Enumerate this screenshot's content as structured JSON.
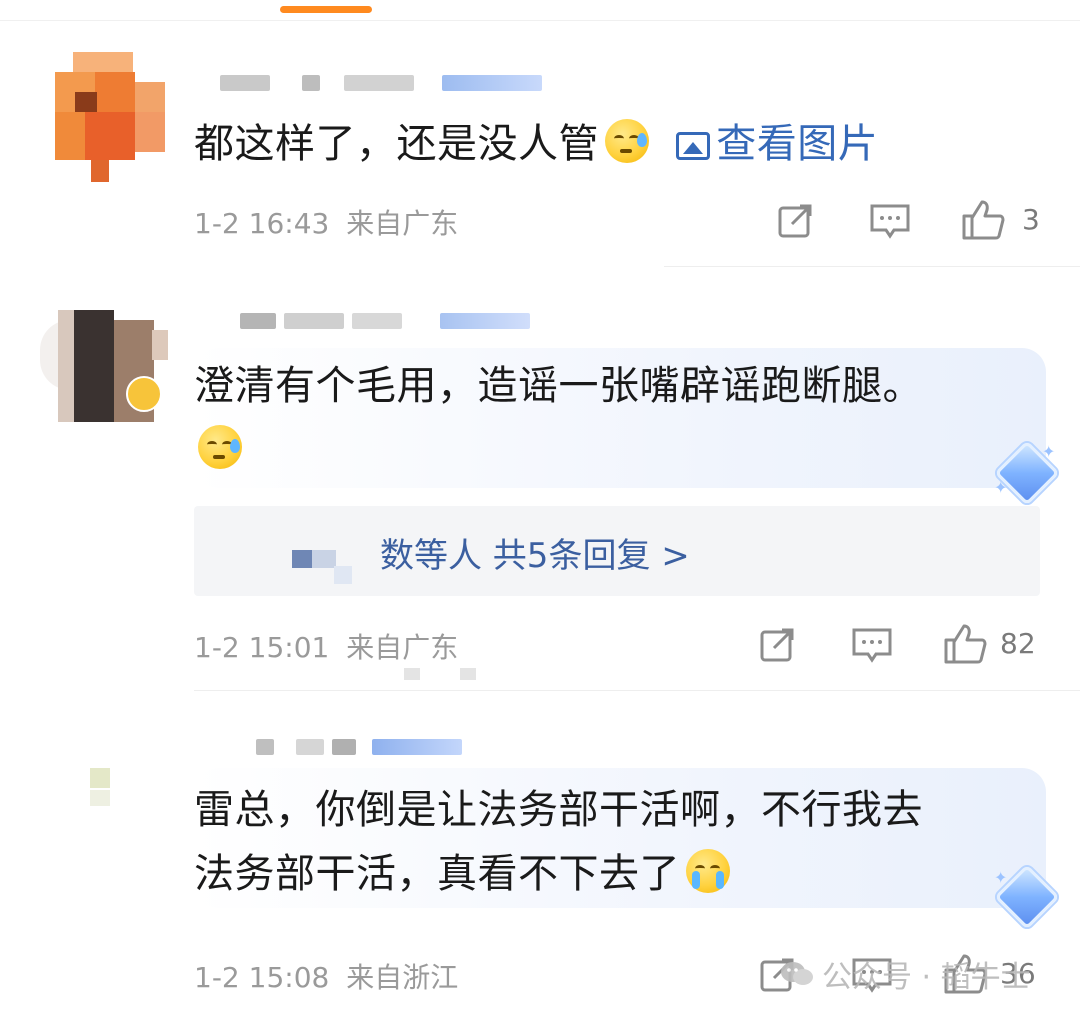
{
  "comments": [
    {
      "text": "都这样了，还是没人管",
      "view_image_label": "查看图片",
      "time": "1-2 16:43",
      "location": "来自广东",
      "likes": "3"
    },
    {
      "text_line1": "澄清有个毛用，造谣一张嘴辟谣跑断腿。",
      "time": "1-2 15:01",
      "location": "来自广东",
      "likes": "82",
      "replies_label": "数等人 共5条回复 >"
    },
    {
      "text_line1": "雷总，你倒是让法务部干活啊，不行我去",
      "text_line2": "法务部干活，真看不下去了",
      "time": "1-2 15:08",
      "location": "来自浙江",
      "likes": "36"
    }
  ],
  "watermark": "公众号 · 韬牛士",
  "colors": {
    "accent_orange": "#ff8a1f",
    "link_blue": "#3569b8",
    "meta_gray": "#9a9a9a"
  },
  "icons": [
    "share-icon",
    "comment-icon",
    "like-icon",
    "image-icon"
  ]
}
